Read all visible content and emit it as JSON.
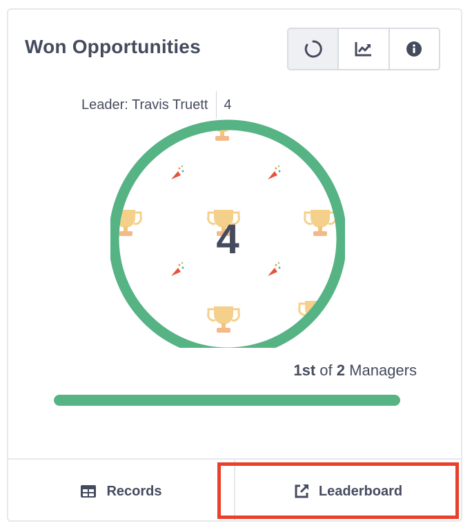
{
  "widget": {
    "title": "Won Opportunities",
    "view_toggles": [
      {
        "icon": "ring-chart-icon",
        "active": true
      },
      {
        "icon": "trend-chart-icon",
        "active": false
      },
      {
        "icon": "info-icon",
        "active": false
      }
    ]
  },
  "leader": {
    "text": "Leader: Travis Truett",
    "value": "4"
  },
  "metric": {
    "value": "4",
    "ring_fill": 1.0
  },
  "rank": {
    "position": "1st",
    "of_label": "of",
    "total": "2",
    "group": "Managers"
  },
  "progress": {
    "fraction": 1.0
  },
  "footer": {
    "records_label": "Records",
    "leaderboard_label": "Leaderboard"
  },
  "colors": {
    "accent_green": "#55b384",
    "text": "#454b5e",
    "highlight": "#e8402a"
  }
}
